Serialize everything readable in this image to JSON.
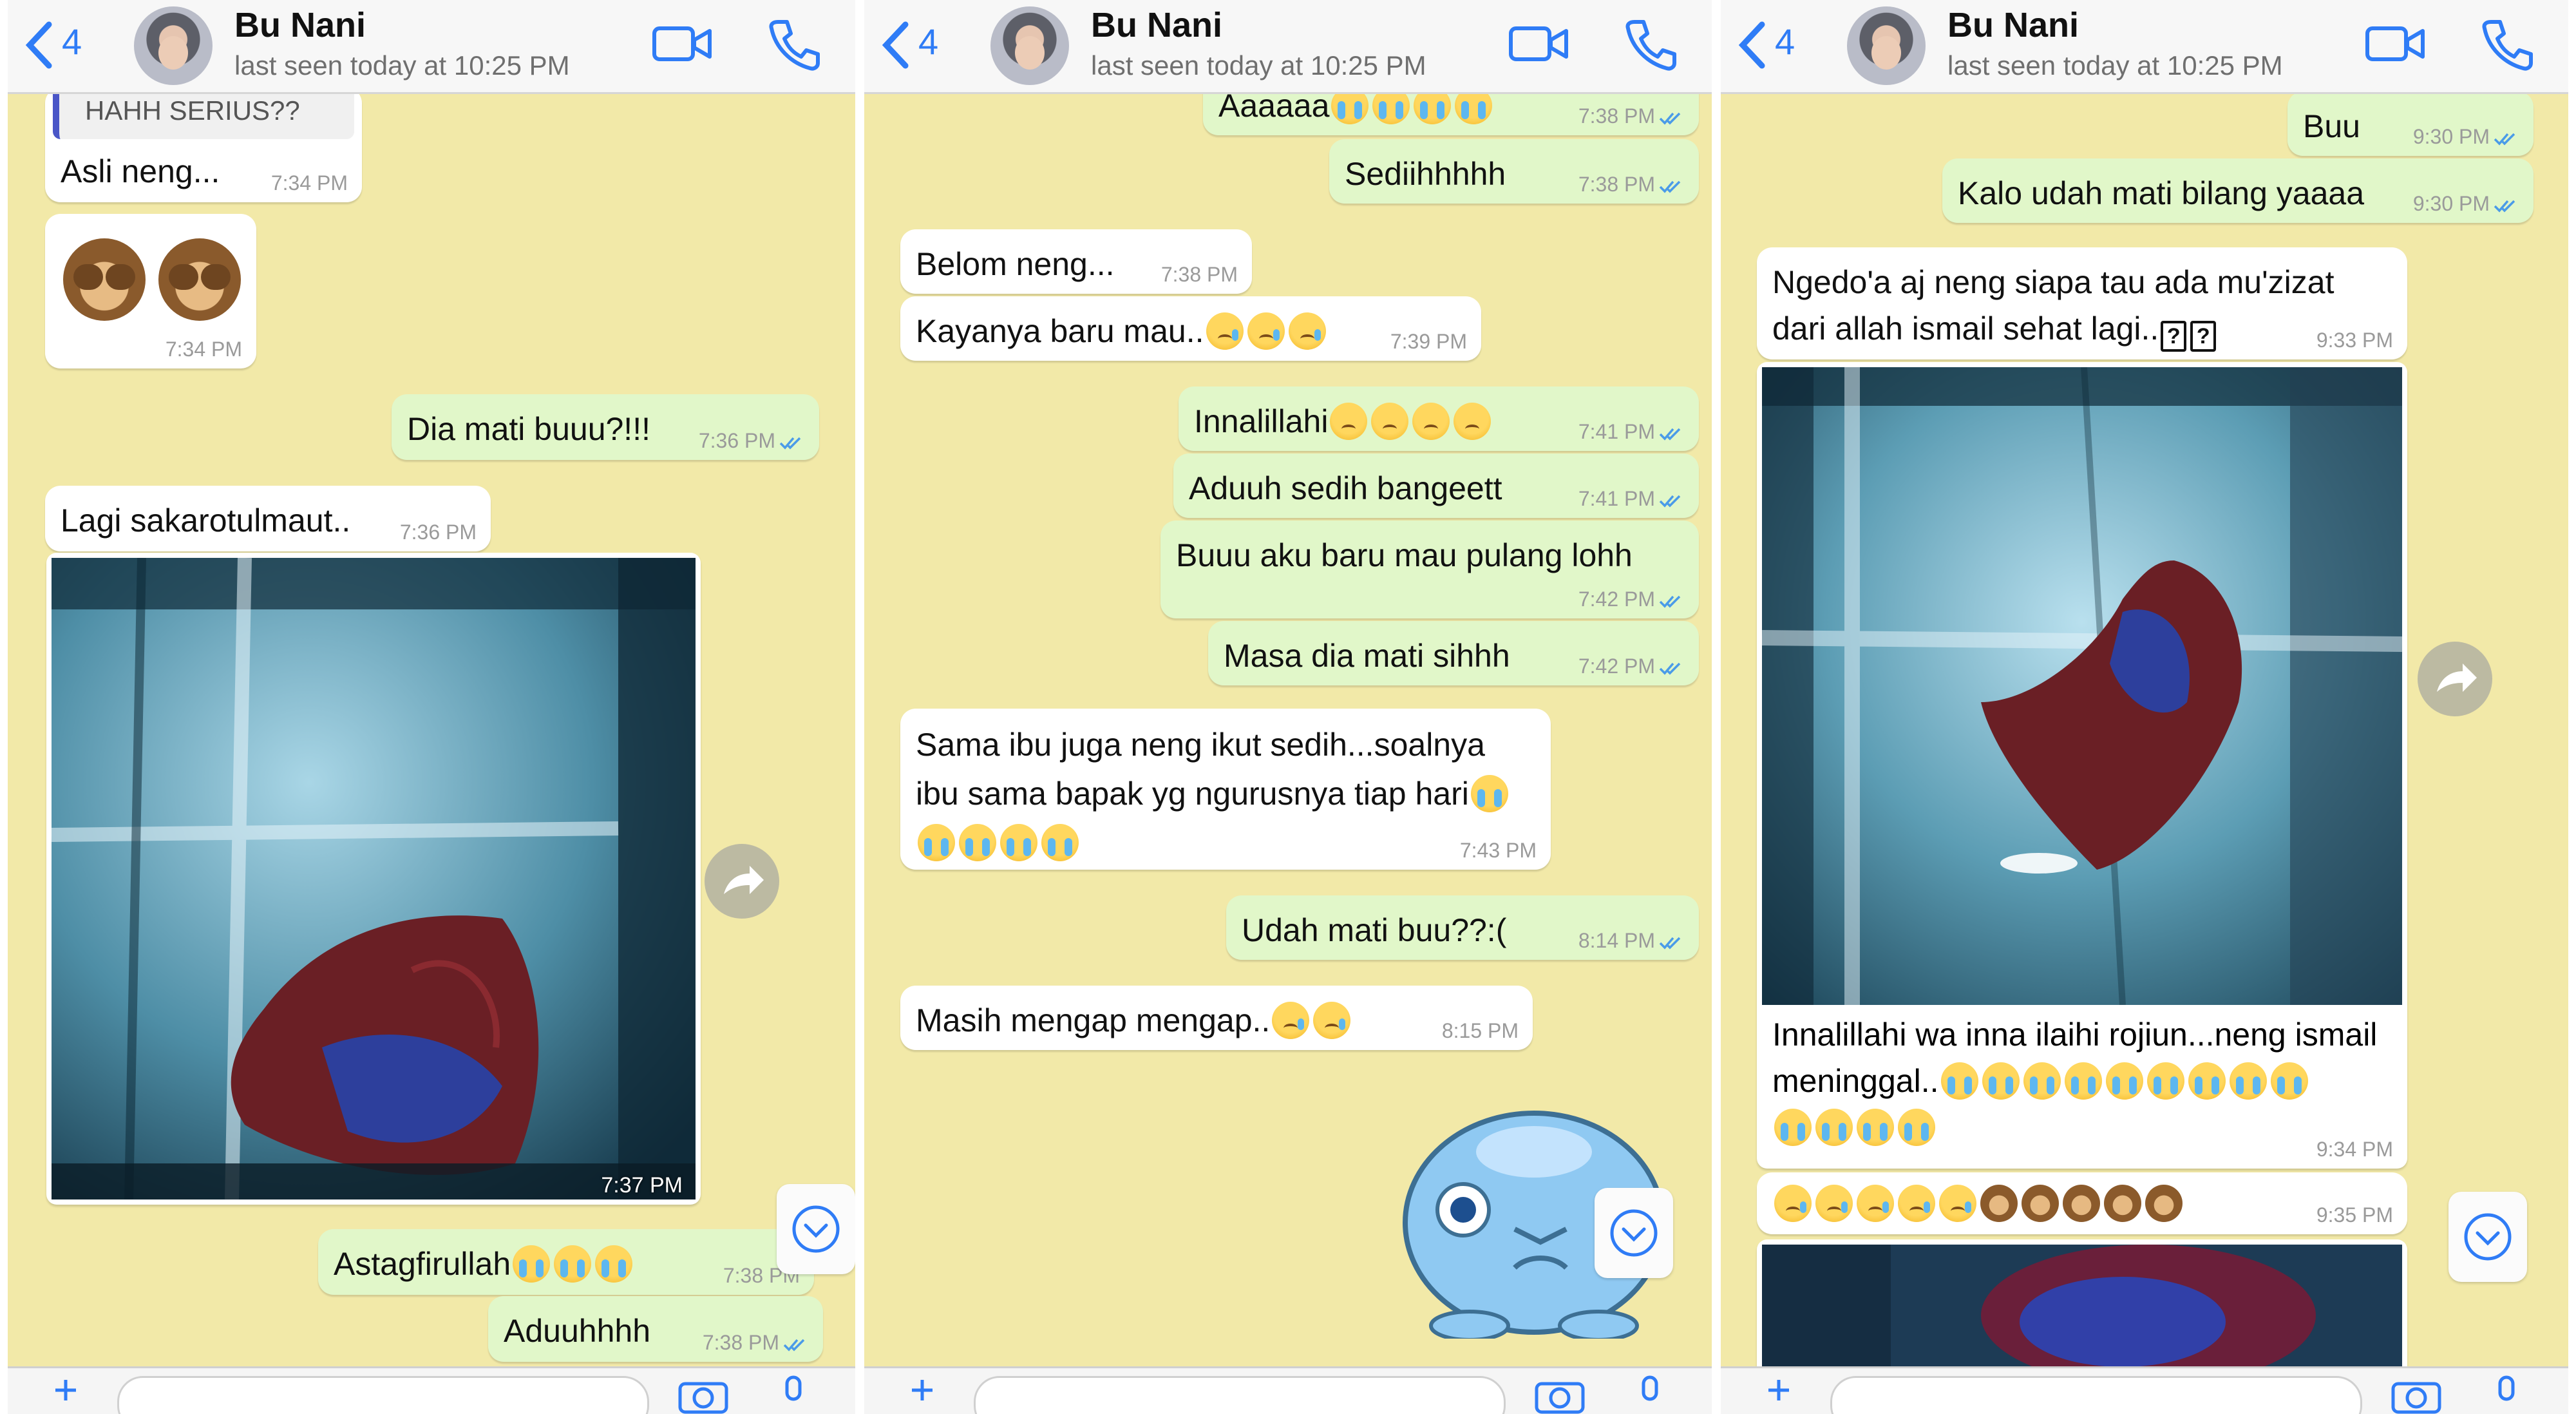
{
  "panels": [
    {
      "header": {
        "back_count": "4",
        "contact_name": "Bu Nani",
        "last_seen": "last seen today at 10:25 PM"
      },
      "messages": [
        {
          "quote": "HAHH SERIUS??",
          "text": "Asli neng...",
          "time": "7:34 PM"
        },
        {
          "emoji": "see-no-evil-monkey x2",
          "time": "7:34 PM"
        },
        {
          "text": "Dia mati buuu?!!!",
          "time": "7:36 PM"
        },
        {
          "text": "Lagi sakarotulmaut..",
          "time": "7:36 PM"
        },
        {
          "photo": "betta fish in tank",
          "time": "7:37 PM"
        },
        {
          "text": "Astagfirullah",
          "time": "7:38 PM"
        },
        {
          "text": "Aduuhhhh",
          "time": "7:38 PM"
        }
      ]
    },
    {
      "header": {
        "back_count": "4",
        "contact_name": "Bu Nani",
        "last_seen": "last seen today at 10:25 PM"
      },
      "messages": [
        {
          "text": "Aaaaaa",
          "time": "7:38 PM"
        },
        {
          "text": "Sediihhhhh",
          "time": "7:38 PM"
        },
        {
          "text": "Belom neng...",
          "time": "7:38 PM"
        },
        {
          "text": "Kayanya baru mau..",
          "time": "7:39 PM"
        },
        {
          "text": "Innalillahi",
          "time": "7:41 PM"
        },
        {
          "text": "Aduuh sedih bangeett",
          "time": "7:41 PM"
        },
        {
          "text": "Buuu aku baru mau pulang lohh",
          "time": "7:42 PM"
        },
        {
          "text": "Masa dia mati sihhh",
          "time": "7:42 PM"
        },
        {
          "line1": "Sama ibu juga neng ikut sedih...soalnya",
          "line2": "ibu sama bapak yg ngurusnya tiap hari",
          "time": "7:43 PM"
        },
        {
          "text": "Udah mati buu??:(",
          "time": "8:14 PM"
        },
        {
          "text": "Masih mengap mengap..",
          "time": "8:15 PM"
        },
        {
          "sticker": "crying blue blob"
        }
      ]
    },
    {
      "header": {
        "back_count": "4",
        "contact_name": "Bu Nani",
        "last_seen": "last seen today at 10:25 PM"
      },
      "messages": [
        {
          "text": "Buu",
          "time": "9:30 PM"
        },
        {
          "text": "Kalo udah mati bilang yaaaa",
          "time": "9:30 PM"
        },
        {
          "line1": "Ngedo'a aj neng siapa tau ada mu'zizat",
          "line2": "dari allah ismail sehat lagi..",
          "qbox": "?",
          "time": "9:33 PM"
        },
        {
          "photo": "betta fish in tank",
          "line1": "Innalillahi wa inna ilaihi rojiun...neng ismail",
          "line2": "meninggal..",
          "time": "9:34 PM"
        },
        {
          "emoji": "sad faces and monkeys",
          "time": "9:35 PM"
        },
        {
          "photo": "betta fish close-up"
        }
      ]
    }
  ],
  "colors": {
    "chat_bg": "#f2e9a8",
    "outgoing": "#e1f7c9",
    "incoming": "#ffffff",
    "accent": "#2f7cf6",
    "read_tick": "#4a9be8"
  },
  "icons": [
    "back-chevron-icon",
    "video-call-icon",
    "phone-icon",
    "forward-icon",
    "scroll-down-icon",
    "camera-icon",
    "microphone-icon",
    "sticker-icon",
    "plus-icon"
  ]
}
